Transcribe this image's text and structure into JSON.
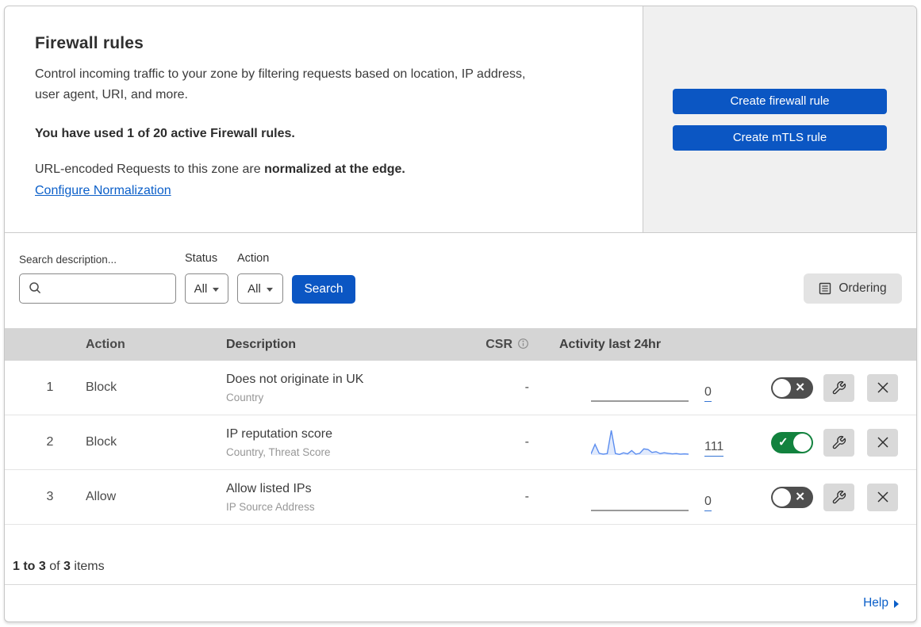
{
  "header": {
    "title": "Firewall rules",
    "description": "Control incoming traffic to your zone by filtering requests based on location, IP address, user agent, URI, and more.",
    "usage_line": "You have used 1 of 20 active Firewall rules.",
    "normalization_prefix": "URL-encoded Requests to this zone are ",
    "normalization_bold": "normalized at the edge.",
    "normalization_link": "Configure Normalization",
    "create_firewall_button": "Create firewall rule",
    "create_mtls_button": "Create mTLS rule"
  },
  "filters": {
    "search_label": "Search description...",
    "search_value": "",
    "status_label": "Status",
    "status_value": "All",
    "action_label": "Action",
    "action_value": "All",
    "search_button": "Search",
    "ordering_button": "Ordering"
  },
  "table": {
    "columns": {
      "action": "Action",
      "description": "Description",
      "csr": "CSR",
      "activity": "Activity last 24hr"
    },
    "rows": [
      {
        "index": "1",
        "action": "Block",
        "description": "Does not originate in UK",
        "criteria": "Country",
        "csr": "-",
        "activity_count": "0",
        "enabled": false
      },
      {
        "index": "2",
        "action": "Block",
        "description": "IP reputation score",
        "criteria": "Country, Threat Score",
        "csr": "-",
        "activity_count": "111",
        "enabled": true
      },
      {
        "index": "3",
        "action": "Allow",
        "description": "Allow listed IPs",
        "criteria": "IP Source Address",
        "csr": "-",
        "activity_count": "0",
        "enabled": false
      }
    ],
    "footer": {
      "range": "1 to 3",
      "of": "of",
      "total": "3",
      "items": "items"
    }
  },
  "help_link": "Help",
  "chart_data": {
    "type": "line",
    "title": "Activity last 24hr sparkline (rule 2)",
    "x_range": [
      0,
      24
    ],
    "values": [
      4,
      38,
      6,
      3,
      5,
      88,
      5,
      2,
      8,
      4,
      16,
      3,
      6,
      22,
      20,
      9,
      12,
      5,
      8,
      6,
      4,
      5,
      3,
      4,
      3
    ],
    "total": 111,
    "line_color": "#5b8def",
    "fill_color": "rgba(91,141,239,0.18)"
  },
  "colors": {
    "primary_blue": "#0b56c3",
    "link_blue": "#0b5fc9",
    "toggle_on_green": "#12823e",
    "toggle_off_gray": "#4e4e4e",
    "header_gray": "#d5d5d5",
    "panel_gray": "#f0f0f0"
  }
}
